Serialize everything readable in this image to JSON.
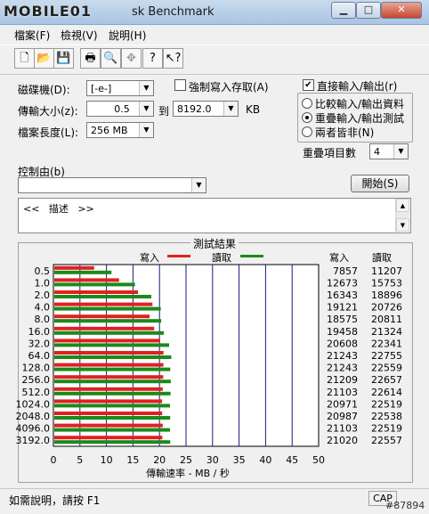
{
  "window": {
    "title_text": "sk Benchmark",
    "logo_text": "MOBILE01"
  },
  "menu": [
    "檔案(F)",
    "檢視(V)",
    "說明(H)"
  ],
  "toolbar": {
    "icons": [
      "new-icon",
      "open-icon",
      "save-icon",
      "print-icon",
      "print-preview-icon",
      "move-icon",
      "help-icon",
      "context-help-icon"
    ]
  },
  "settings": {
    "drive_label": "磁碟機(D):",
    "drive_value": "[-e-]",
    "transfer_size_label": "傳輸大小(z):",
    "transfer_from": "0.5",
    "to_label": "到",
    "transfer_to": "8192.0",
    "kb_label": "KB",
    "file_length_label": "檔案長度(L):",
    "file_length_value": "256 MB",
    "force_write_label": "強制寫入存取(A)",
    "direct_io_label": "直接輸入/輸出(r)",
    "radio_compare": "比較輸入/輸出資料",
    "radio_overlap": "重疊輸入/輸出測試",
    "radio_neither": "兩者皆非(N)",
    "queue_label": "重疊項目數",
    "queue_value": "4",
    "controlled_by_label": "控制由(b)",
    "controlled_by_value": "",
    "start_button": "開始(S)",
    "description_text": "<<   描述   >>"
  },
  "results": {
    "title": "測試結果",
    "write_legend": "寫入",
    "read_legend": "讀取",
    "write_col_header": "寫入",
    "read_col_header": "讀取",
    "write_color": "#e02020",
    "read_color": "#1a8a1a"
  },
  "chart_data": {
    "type": "bar",
    "orientation": "horizontal",
    "title": "測試結果",
    "xlabel": "傳輸速率 - MB / 秒",
    "xlim": [
      0,
      50
    ],
    "xticks": [
      "0",
      "5",
      "10",
      "15",
      "20",
      "25",
      "30",
      "35",
      "40",
      "45",
      "50"
    ],
    "categories": [
      "0.5",
      "1.0",
      "2.0",
      "4.0",
      "8.0",
      "16.0",
      "32.0",
      "64.0",
      "128.0",
      "256.0",
      "512.0",
      "1024.0",
      "2048.0",
      "4096.0",
      "3192.0"
    ],
    "series": [
      {
        "name": "寫入",
        "values": [
          7857,
          12673,
          16343,
          19121,
          18575,
          19458,
          20608,
          21243,
          21243,
          21209,
          21103,
          20971,
          20987,
          21103,
          21020
        ]
      },
      {
        "name": "讀取",
        "values": [
          11207,
          15753,
          18896,
          20726,
          20811,
          21324,
          22341,
          22755,
          22559,
          22657,
          22614,
          22519,
          22538,
          22519,
          22557
        ]
      }
    ],
    "legend": "top"
  },
  "status": {
    "help_text": "如需說明，請按 F1",
    "caps": "CAP",
    "watermark": "#87894"
  }
}
